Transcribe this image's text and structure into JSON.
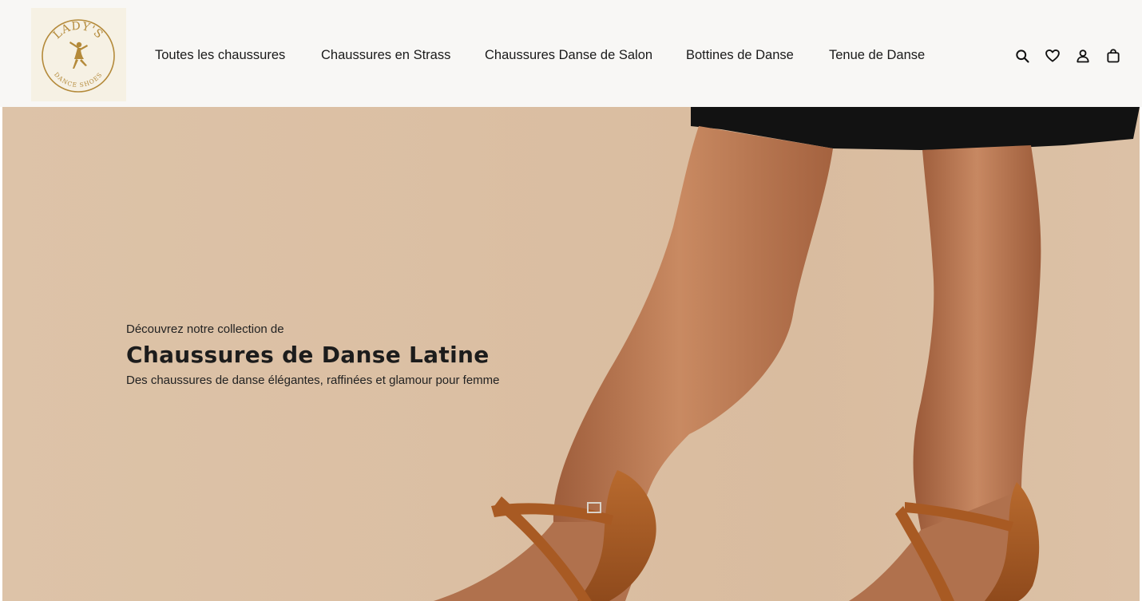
{
  "brand": {
    "logo_text_top": "LADY'S",
    "logo_text_bottom": "DANCE SHOES",
    "logo_color": "#b48a3a"
  },
  "nav": {
    "items": [
      {
        "label": "Toutes les chaussures"
      },
      {
        "label": "Chaussures en Strass"
      },
      {
        "label": "Chaussures Danse de Salon"
      },
      {
        "label": "Bottines de Danse"
      },
      {
        "label": "Tenue de Danse"
      }
    ]
  },
  "header_icons": [
    "search-icon",
    "heart-icon",
    "account-icon",
    "bag-icon"
  ],
  "hero": {
    "eyebrow": "Découvrez notre collection de",
    "title": "Chaussures de Danse Latine",
    "subtitle": "Des chaussures de danse élégantes, raffinées et glamour pour femme"
  },
  "colors": {
    "header_bg": "#f8f7f5",
    "hero_bg": "#dbbfa3",
    "skin": "#b77450",
    "shoe": "#a85a23",
    "skirt": "#121212"
  }
}
